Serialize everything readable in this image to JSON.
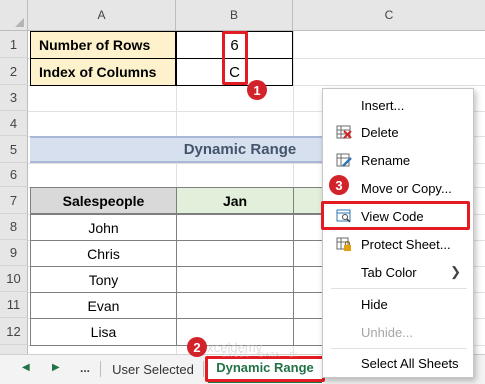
{
  "columns": [
    "A",
    "B",
    "C"
  ],
  "rows": [
    "1",
    "2",
    "3",
    "4",
    "5",
    "6",
    "7",
    "8",
    "9",
    "10",
    "11",
    "12"
  ],
  "inputs": {
    "rows_label": "Number of Rows",
    "rows_value": "6",
    "cols_label": "Index of Columns",
    "cols_value": "C"
  },
  "section_title": "Dynamic Range",
  "table": {
    "headers": [
      "Salespeople",
      "Jan"
    ],
    "people": [
      "John",
      "Chris",
      "Tony",
      "Evan",
      "Lisa"
    ]
  },
  "context_menu": {
    "items": [
      {
        "label": "Insert...",
        "icon": "none",
        "enabled": true
      },
      {
        "label": "Delete",
        "icon": "delete-sheet-icon",
        "enabled": true
      },
      {
        "label": "Rename",
        "icon": "rename-icon",
        "enabled": true
      },
      {
        "label": "Move or Copy...",
        "icon": "none",
        "enabled": true
      },
      {
        "label": "View Code",
        "icon": "view-code-icon",
        "enabled": true
      },
      {
        "label": "Protect Sheet...",
        "icon": "protect-sheet-icon",
        "enabled": true
      },
      {
        "label": "Tab Color",
        "icon": "none",
        "enabled": true,
        "submenu": true
      },
      {
        "label": "Hide",
        "icon": "none",
        "enabled": true
      },
      {
        "label": "Unhide...",
        "icon": "none",
        "enabled": false
      },
      {
        "label": "Select All Sheets",
        "icon": "none",
        "enabled": true
      }
    ]
  },
  "sheet_tabs": {
    "overflow": "...",
    "tabs": [
      "User Selected",
      "Dynamic Range"
    ],
    "active": "Dynamic Range"
  },
  "annotations": [
    "1",
    "2",
    "3"
  ],
  "watermark": {
    "brand": "exceldemy",
    "tagline": "EXCEL · DATA · BI"
  },
  "colors": {
    "highlight_red": "#e31b23",
    "excel_green": "#217346",
    "label_fill": "#fdf2cc",
    "title_fill": "#d7e0ef",
    "header_gray": "#d9d9d9",
    "header_green": "#e2efda"
  }
}
